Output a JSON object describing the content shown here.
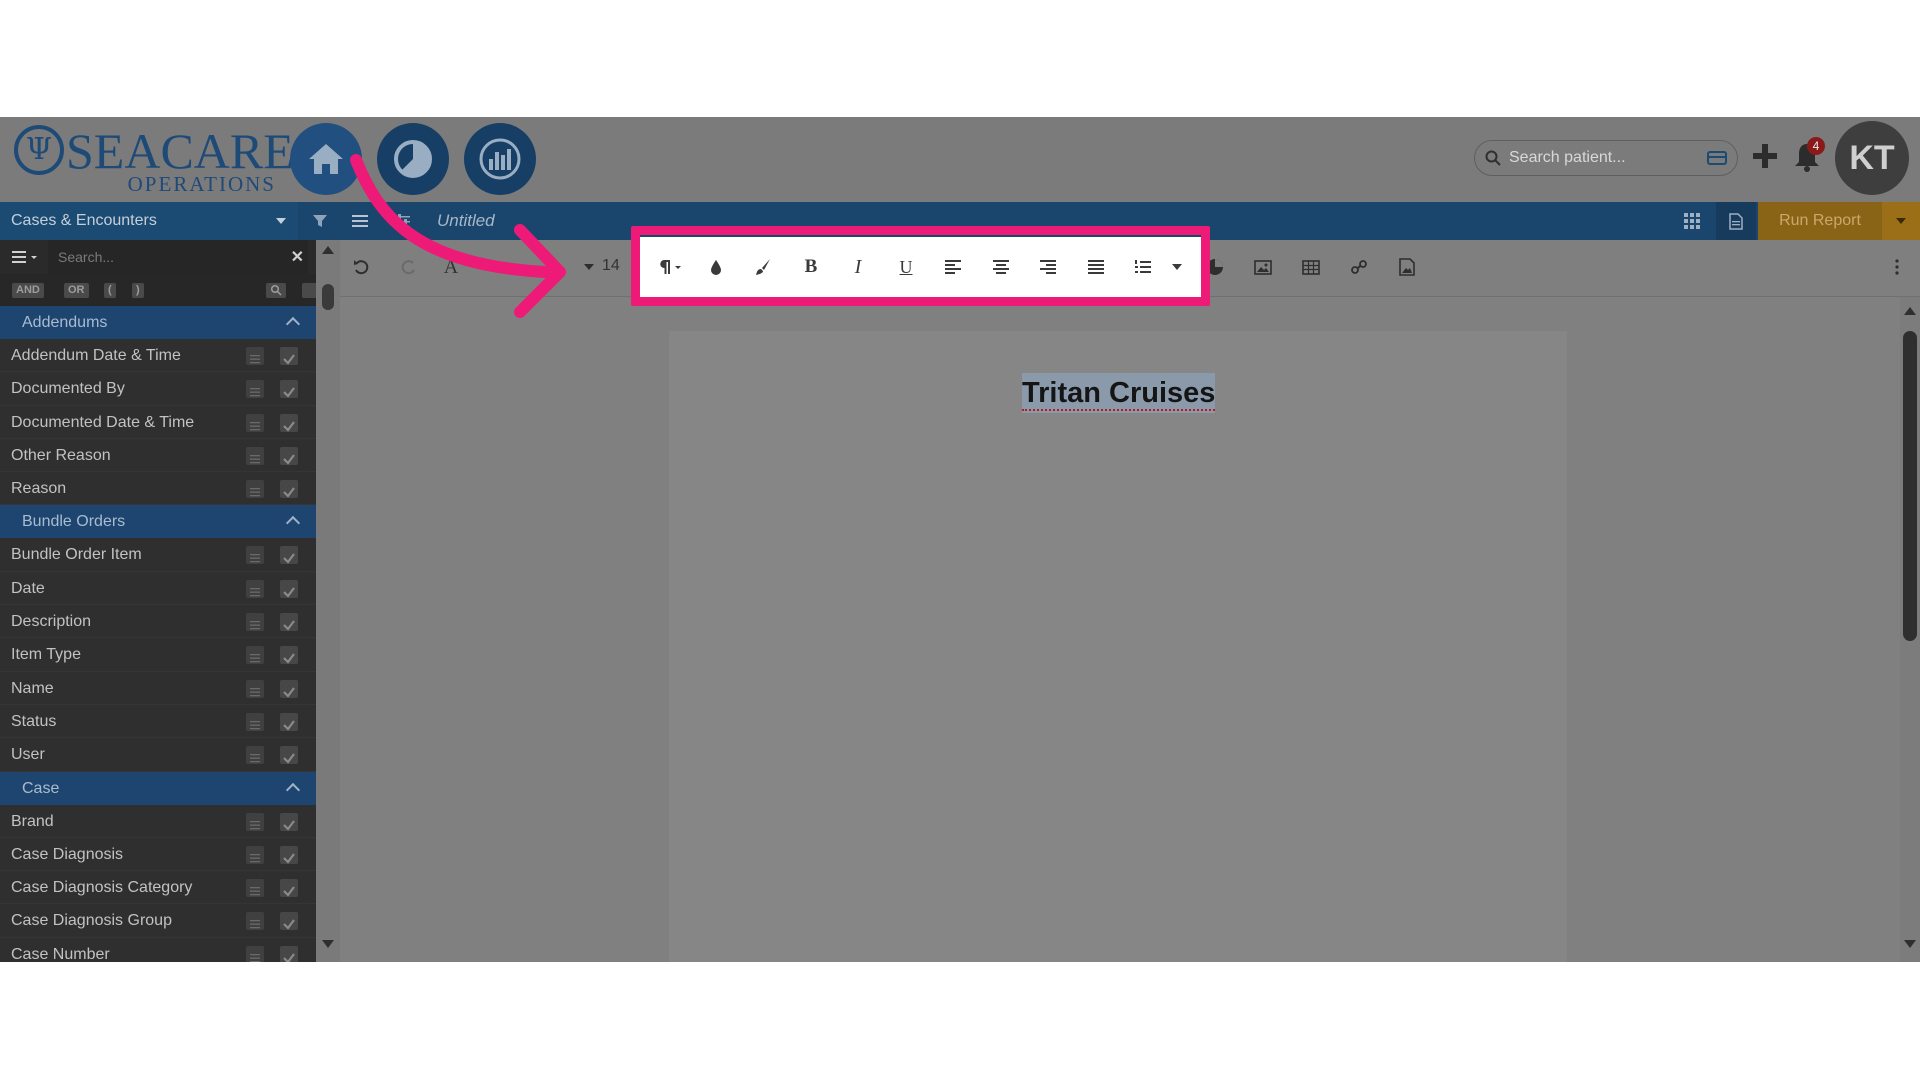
{
  "header": {
    "logo": {
      "name": "SEACARE",
      "subtitle": "OPERATIONS"
    },
    "search": {
      "placeholder": "Search patient..."
    },
    "notifications_count": "4",
    "avatar_initials": "KT",
    "icons": [
      "home-icon",
      "pie-chart-icon",
      "bar-chart-icon",
      "search-icon",
      "id-card-icon",
      "plus-icon",
      "bell-icon"
    ]
  },
  "topbar": {
    "source": "Cases & Encounters",
    "document_title": "Untitled",
    "run_report_label": "Run Report"
  },
  "sidebar": {
    "search_placeholder": "Search...",
    "logic_buttons": [
      "AND",
      "OR",
      "(",
      ")"
    ],
    "groups": [
      {
        "label": "Addendums",
        "fields": [
          "Addendum Date & Time",
          "Documented By",
          "Documented Date & Time",
          "Other Reason",
          "Reason"
        ]
      },
      {
        "label": "Bundle Orders",
        "fields": [
          "Bundle Order Item",
          "Date",
          "Description",
          "Item Type",
          "Name",
          "Status",
          "User"
        ]
      },
      {
        "label": "Case",
        "fields": [
          "Brand",
          "Case Diagnosis",
          "Case Diagnosis Category",
          "Case Diagnosis Group",
          "Case Number"
        ]
      }
    ]
  },
  "toolbar": {
    "font_size": "14",
    "highlighted_tools": [
      "paragraph-format",
      "text-color",
      "background-color",
      "bold",
      "italic",
      "underline",
      "align-left",
      "align-center",
      "align-right",
      "justify",
      "ordered-list"
    ],
    "highlight_color": "#ee1a78"
  },
  "editor": {
    "heading": "Tritan Cruises"
  },
  "colors": {
    "brand_blue": "#1a466d",
    "run_report": "#8a6416",
    "annotation": "#ee1a78"
  }
}
